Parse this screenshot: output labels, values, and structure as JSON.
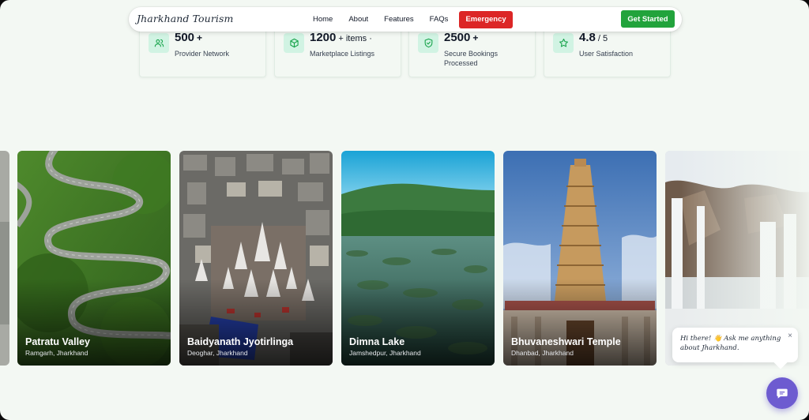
{
  "nav": {
    "brand": "Jharkhand Tourism",
    "links": [
      "Home",
      "About",
      "Features",
      "FAQs"
    ],
    "emergency": "Emergency",
    "cta": "Get Started"
  },
  "stats": [
    {
      "value": "500",
      "suffix": "+",
      "label": "Provider Network",
      "icon": "users-icon"
    },
    {
      "value": "1200",
      "suffix": "+ items ·",
      "label": "Marketplace Listings",
      "icon": "box-icon"
    },
    {
      "value": "2500",
      "suffix": "+",
      "label": "Secure Bookings Processed",
      "icon": "shield-check-icon"
    },
    {
      "value": "4.8",
      "suffix": "/ 5",
      "label": "User Satisfaction",
      "icon": "star-icon"
    }
  ],
  "destinations": [
    {
      "name": "Patratu Valley",
      "location": "Ramgarh, Jharkhand"
    },
    {
      "name": "Baidyanath Jyotirlinga",
      "location": "Deoghar, Jharkhand"
    },
    {
      "name": "Dimna Lake",
      "location": "Jamshedpur, Jharkhand"
    },
    {
      "name": "Bhuvaneshwari Temple",
      "location": "Dhanbad, Jharkhand"
    },
    {
      "name": "",
      "location": ""
    }
  ],
  "chat": {
    "greeting": "Hi there! 👋 Ask me anything about Jharkhand.",
    "close": "×"
  },
  "colors": {
    "accent_green": "#22a33c",
    "emergency_red": "#dc2626",
    "icon_bg": "#d1f3e3",
    "chat_purple": "#6d5bd0"
  }
}
